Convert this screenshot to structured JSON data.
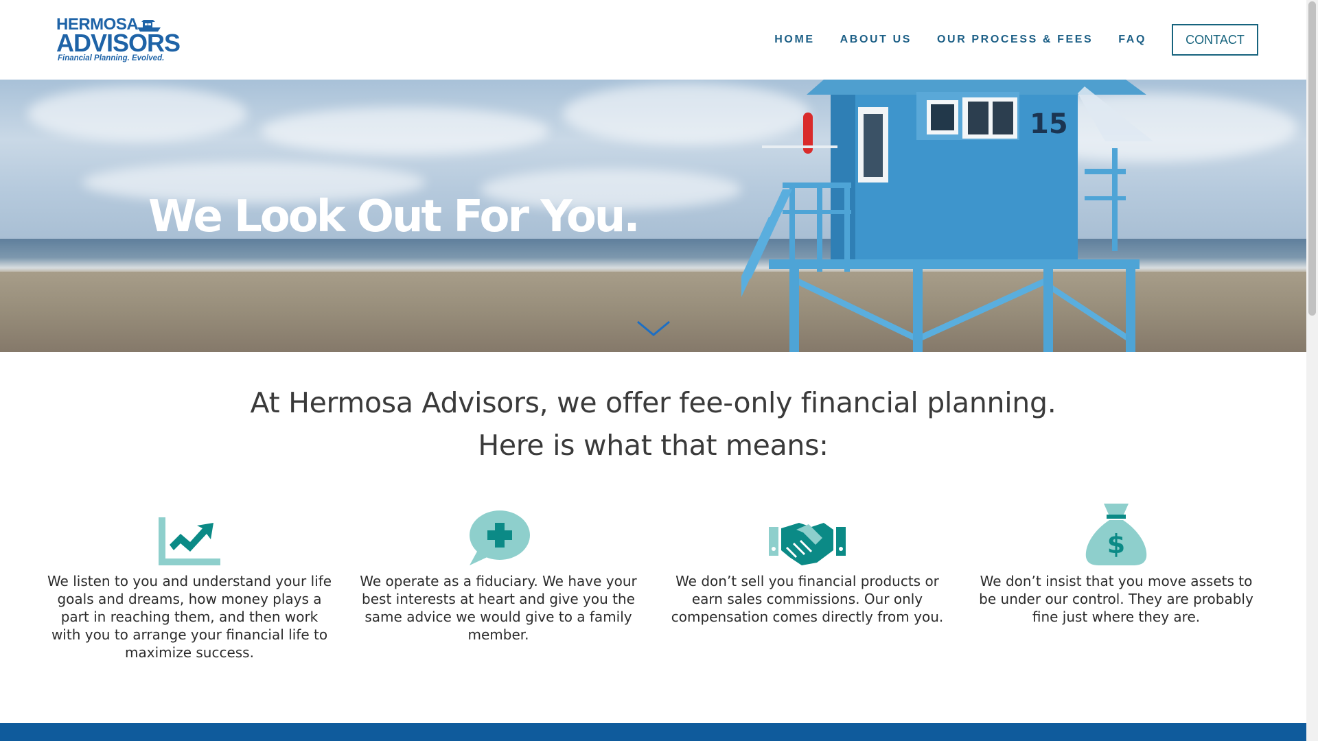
{
  "header": {
    "logo": {
      "line1": "HERMOSA",
      "line2": "ADVISORS",
      "tagline": "Financial Planning. Evolved."
    },
    "nav": [
      {
        "label": "HOME"
      },
      {
        "label": "ABOUT US"
      },
      {
        "label": "OUR PROCESS & FEES"
      },
      {
        "label": "FAQ"
      }
    ],
    "contact_label": "CONTACT"
  },
  "hero": {
    "title": "We Look Out For You.",
    "lifeguard_tower_number": "15"
  },
  "intro": {
    "line1": "At Hermosa Advisors, we offer fee-only financial planning.",
    "line2": "Here is what that means:"
  },
  "features": [
    {
      "icon": "chart-trending-up-icon",
      "text": "We listen to you and understand your life goals and dreams, how money plays a part in reaching them, and then work with you to arrange your financial life to maximize success."
    },
    {
      "icon": "speech-bubble-plus-icon",
      "text": "We operate as a fiduciary. We have your best interests at heart and give you the same advice we would give to a family member."
    },
    {
      "icon": "handshake-icon",
      "text": "We don’t sell you financial products or earn sales commissions. Our only compensation comes directly from you."
    },
    {
      "icon": "money-bag-icon",
      "text": "We don’t insist that you move assets to be under our control. They are probably fine just where they are."
    }
  ],
  "colors": {
    "brand_blue": "#1e63a7",
    "nav_text": "#1c5f86",
    "icon_teal_dark": "#0b8a86",
    "icon_teal_light": "#8ecfcc",
    "bottom_bar": "#0f5b9c"
  }
}
